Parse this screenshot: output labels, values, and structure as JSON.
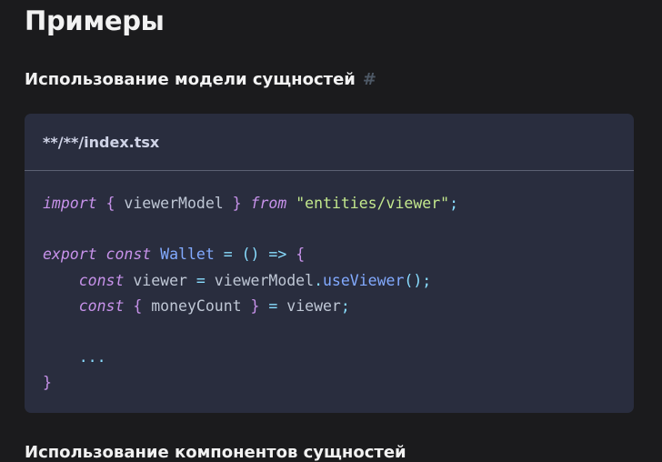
{
  "page": {
    "heading": "Примеры",
    "section1": {
      "title": "Использование модели сущностей",
      "anchor": "#"
    },
    "section2": {
      "title": "Использование компонентов сущностей"
    }
  },
  "code_block": {
    "filename": "**/**/index.tsx",
    "lines": {
      "l1": {
        "import": "import",
        "ob": "{",
        "name": "viewerModel",
        "cb": "}",
        "from": "from",
        "str": "\"entities/viewer\"",
        "semi": ";"
      },
      "l3": {
        "export": "export",
        "const": "const",
        "name": "Wallet",
        "eq": "=",
        "parens": "()",
        "arrow": "=>",
        "ob": "{"
      },
      "l4": {
        "const": "const",
        "var": "viewer",
        "eq": "=",
        "obj": "viewerModel",
        "dot": ".",
        "method": "useViewer",
        "call": "();"
      },
      "l5": {
        "const": "const",
        "ob": "{",
        "var": "moneyCount",
        "cb": "}",
        "eq": "=",
        "rhs": "viewer",
        "semi": ";"
      },
      "l7": {
        "dots": "..."
      },
      "l8": {
        "cb": "}"
      }
    }
  },
  "colors": {
    "background": "#1b1b1d",
    "code_background": "#292d3e",
    "keyword": "#c792ea",
    "function": "#82aaff",
    "string": "#c3e88d",
    "operator": "#89ddff"
  }
}
